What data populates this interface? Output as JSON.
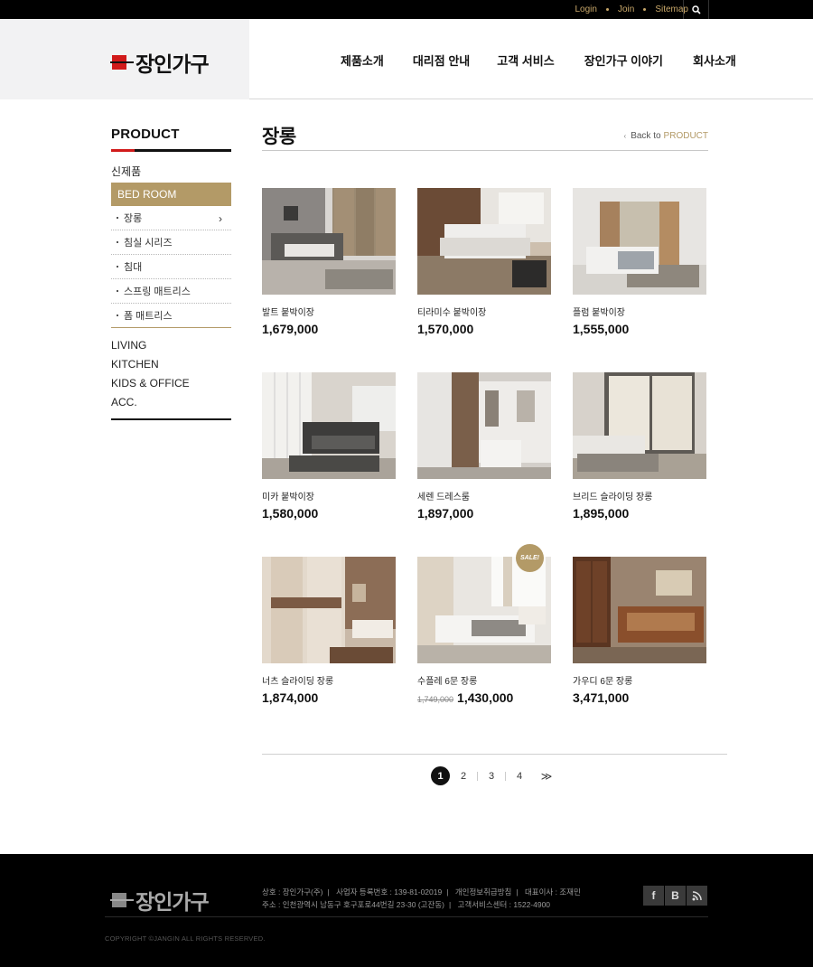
{
  "topbar": {
    "links": [
      "Login",
      "Join",
      "Sitemap"
    ]
  },
  "header": {
    "logo_text": "장인가구",
    "nav": [
      "제품소개",
      "대리점 안내",
      "고객 서비스",
      "장인가구 이야기",
      "회사소개"
    ]
  },
  "sidebar": {
    "title": "PRODUCT",
    "top_item": "신제품",
    "active_category": "BED ROOM",
    "sub_items": [
      "장롱",
      "침실 시리즈",
      "침대",
      "스프링 매트리스",
      "폼 매트리스"
    ],
    "bottom_items": [
      "LIVING",
      "KITCHEN",
      "KIDS & OFFICE",
      "ACC."
    ]
  },
  "content": {
    "title": "장롱",
    "back_label": "Back to",
    "back_target": "PRODUCT"
  },
  "products": [
    {
      "name": "발트 붙박이장",
      "price": "1,679,000",
      "old_price": "",
      "sale": false
    },
    {
      "name": "티라미수 붙박이장",
      "price": "1,570,000",
      "old_price": "",
      "sale": false
    },
    {
      "name": "플럼 붙박이장",
      "price": "1,555,000",
      "old_price": "",
      "sale": false
    },
    {
      "name": "미카 붙박이장",
      "price": "1,580,000",
      "old_price": "",
      "sale": false
    },
    {
      "name": "세렌 드레스룸",
      "price": "1,897,000",
      "old_price": "",
      "sale": false
    },
    {
      "name": "브리드 슬라이딩 장롱",
      "price": "1,895,000",
      "old_price": "",
      "sale": false
    },
    {
      "name": "너츠 슬라이딩 장롱",
      "price": "1,874,000",
      "old_price": "",
      "sale": false
    },
    {
      "name": "수플레 6문 장롱",
      "price": "1,430,000",
      "old_price": "1,749,000",
      "sale": true
    },
    {
      "name": "가우디 6문 장롱",
      "price": "3,471,000",
      "old_price": "",
      "sale": false
    }
  ],
  "sale_badge": "SALE!",
  "pagination": {
    "current": "1",
    "pages": [
      "2",
      "3",
      "4"
    ],
    "next": "≫"
  },
  "footer": {
    "logo_text": "장인가구",
    "line1": [
      "상호 : 장인가구(주)",
      "사업자 등록번호 : 139-81-02019",
      "개인정보취급방침",
      "대표이사 : 조재민"
    ],
    "line2": [
      "주소 : 인천광역시 남동구 호구포로44번길 23-30 (고잔동)",
      "고객서비스센터 : 1522-4900"
    ],
    "social": [
      "f",
      "B",
      "rss"
    ],
    "copyright": "COPYRIGHT ©JANGIN ALL RIGHTS RESERVED."
  },
  "colors": {
    "accent_gold": "#b39a67",
    "brand_red": "#d11a1a",
    "topbar_link": "#c9a86a"
  }
}
